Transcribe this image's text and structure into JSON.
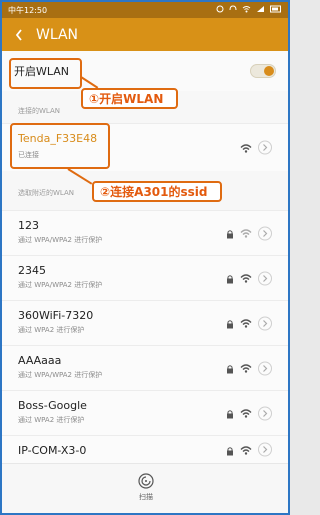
{
  "status": {
    "carrier": "中午12:50",
    "icons": [
      "alarm-icon",
      "headset-icon",
      "wifi-icon",
      "signal-icon",
      "battery-icon"
    ]
  },
  "header": {
    "title": "WLAN"
  },
  "toggle": {
    "label": "开启WLAN",
    "enabled": true
  },
  "sections": {
    "connected_label": "连接的WLAN",
    "nearby_label": "选取附近的WLAN"
  },
  "connected_network": {
    "ssid": "Tenda_F33E48",
    "status": "已连接"
  },
  "networks": [
    {
      "ssid": "123",
      "security": "通过 WPA/WPA2 进行保护"
    },
    {
      "ssid": "2345",
      "security": "通过 WPA/WPA2 进行保护"
    },
    {
      "ssid": "360WiFi-7320",
      "security": "通过 WPA2 进行保护"
    },
    {
      "ssid": "AAAaaa",
      "security": "通过 WPA/WPA2 进行保护"
    },
    {
      "ssid": "Boss-Google",
      "security": "通过 WPA2 进行保护"
    },
    {
      "ssid": "IP-COM-X3-0",
      "security": ""
    }
  ],
  "annotations": {
    "step1": "①开启WLAN",
    "step2": "②连接A301的ssid"
  },
  "bottom": {
    "scan_label": "扫描"
  },
  "colors": {
    "accent": "#d89117",
    "annotation": "#e35a0e",
    "frame": "#2d76c4"
  }
}
